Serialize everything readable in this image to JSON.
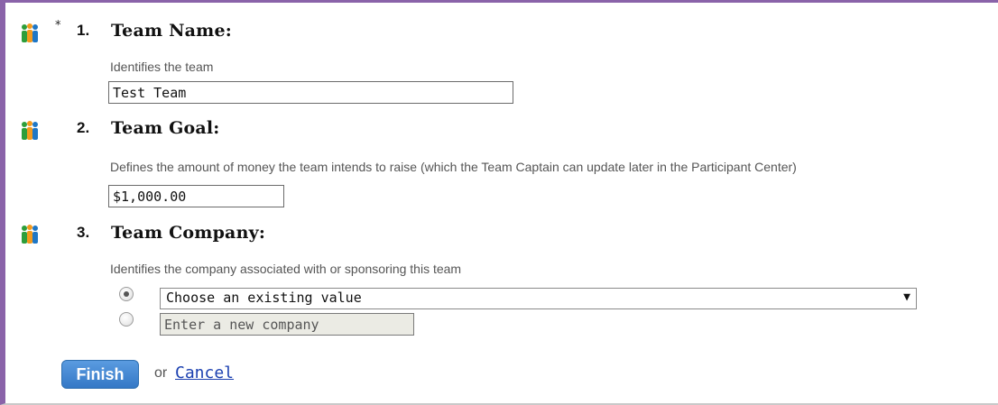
{
  "form": {
    "fields": [
      {
        "number": "1.",
        "required_marker": "*",
        "label": "Team Name:",
        "description": "Identifies the team",
        "value": "Test Team"
      },
      {
        "number": "2.",
        "label": "Team Goal:",
        "description": "Defines the amount of money the team intends to raise (which the Team Captain can update later in the Participant Center)",
        "value": "$1,000.00"
      },
      {
        "number": "3.",
        "label": "Team Company:",
        "description": "Identifies the company associated with or sponsoring this team",
        "select_value": "Choose an existing value",
        "new_company_placeholder": "Enter a new company",
        "selected_option": "existing"
      }
    ],
    "icon": "team-people-icon",
    "icon_colors": [
      "#2e9e3a",
      "#f39a1c",
      "#1f77c6"
    ],
    "actions": {
      "finish_label": "Finish",
      "or_text": "or",
      "cancel_label": "Cancel"
    },
    "colors": {
      "frame_accent": "#8a63a9",
      "button": "#3f87d4",
      "link": "#1a3fb0"
    }
  }
}
